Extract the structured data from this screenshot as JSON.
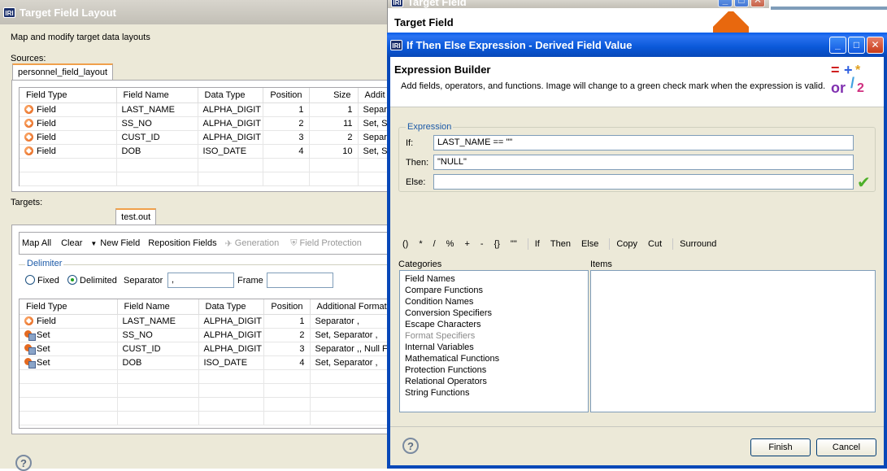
{
  "back_window": {
    "title": "Target Field Layout",
    "description": "Map and modify target data layouts",
    "sources_label": "Sources:",
    "sources_tab": "personnel_field_layout",
    "sources_columns": [
      "Field Type",
      "Field Name",
      "Data Type",
      "Position",
      "Size",
      "Addit"
    ],
    "sources_rows": [
      {
        "type": "Field",
        "name": "LAST_NAME",
        "dtype": "ALPHA_DIGIT",
        "pos": "1",
        "size": "1",
        "add": "Separ"
      },
      {
        "type": "Field",
        "name": "SS_NO",
        "dtype": "ALPHA_DIGIT",
        "pos": "2",
        "size": "11",
        "add": "Set, S"
      },
      {
        "type": "Field",
        "name": "CUST_ID",
        "dtype": "ALPHA_DIGIT",
        "pos": "3",
        "size": "2",
        "add": "Separ"
      },
      {
        "type": "Field",
        "name": "DOB",
        "dtype": "ISO_DATE",
        "pos": "4",
        "size": "10",
        "add": "Set, S"
      }
    ],
    "targets_label": "Targets:",
    "targets_tab": "test.out",
    "toolbar": {
      "map_all": "Map All",
      "clear": "Clear",
      "new_field": "New Field",
      "reposition": "Reposition Fields",
      "generation": "Generation",
      "field_protection": "Field Protection"
    },
    "delimiter": {
      "label": "Delimiter",
      "fixed": "Fixed",
      "delimited": "Delimited",
      "separator_label": "Separator",
      "separator_value": ",",
      "frame_label": "Frame",
      "frame_value": ""
    },
    "targets_columns": [
      "Field Type",
      "Field Name",
      "Data Type",
      "Position",
      "Additional Format"
    ],
    "targets_rows": [
      {
        "type": "Field",
        "icon": "field",
        "name": "LAST_NAME",
        "dtype": "ALPHA_DIGIT",
        "pos": "1",
        "add": "Separator ,"
      },
      {
        "type": "Set",
        "icon": "set",
        "name": "SS_NO",
        "dtype": "ALPHA_DIGIT",
        "pos": "2",
        "add": "Set, Separator ,"
      },
      {
        "type": "Set",
        "icon": "set",
        "name": "CUST_ID",
        "dtype": "ALPHA_DIGIT",
        "pos": "3",
        "add": "Separator ,, Null F"
      },
      {
        "type": "Set",
        "icon": "set",
        "name": "DOB",
        "dtype": "ISO_DATE",
        "pos": "4",
        "add": "Set, Separator ,"
      }
    ]
  },
  "middle_window": {
    "title": "Target Field",
    "heading": "Target Field"
  },
  "dialog": {
    "title": "If Then Else Expression - Derived Field Value",
    "header_title": "Expression Builder",
    "header_desc": "Add fields, operators, and functions. Image will change to a green check mark when the expression is valid.",
    "expression_label": "Expression",
    "if_label": "If:",
    "if_value": "LAST_NAME == \"\"",
    "then_label": "Then:",
    "then_value": "\"NULL\"",
    "else_label": "Else:",
    "else_value": "",
    "operators": [
      "()",
      "*",
      "/",
      "%",
      "+",
      "-",
      "{}",
      "\"\""
    ],
    "keywords": [
      "If",
      "Then",
      "Else"
    ],
    "edit_ops": [
      "Copy",
      "Cut"
    ],
    "surround": "Surround",
    "categories_label": "Categories",
    "items_label": "Items",
    "categories": [
      "Field Names",
      "Compare Functions",
      "Condition Names",
      "Conversion Specifiers",
      "Escape Characters",
      "Format Specifiers",
      "Internal Variables",
      "Mathematical Functions",
      "Protection Functions",
      "Relational Operators",
      "String Functions"
    ],
    "finish": "Finish",
    "cancel": "Cancel"
  },
  "colors": {
    "title_blue": "#0a58d8",
    "accent_orange": "#e05a10",
    "valid_green": "#4caf28"
  }
}
